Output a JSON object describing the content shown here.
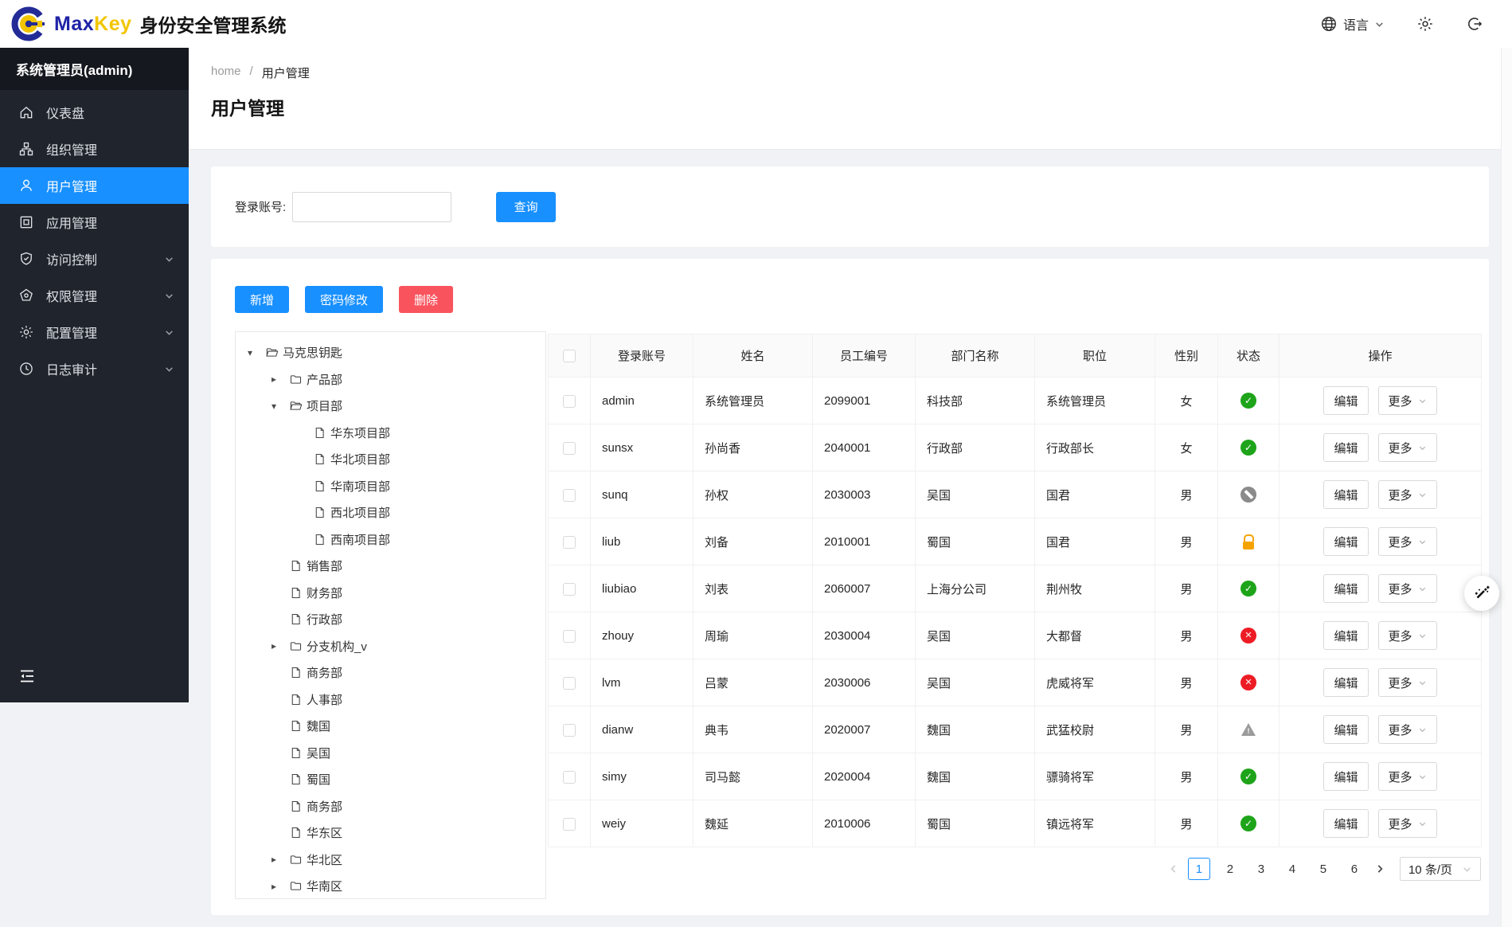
{
  "header": {
    "brand_max": "Max",
    "brand_key": "Key",
    "brand_title": "身份安全管理系统",
    "logo_icon": "maxkey-logo-icon",
    "language": {
      "label": "语言",
      "icon": "globe-icon",
      "chevron_icon": "chevron-down-icon"
    },
    "settings_icon": "gear-icon",
    "logout_icon": "logout-icon"
  },
  "sidebar": {
    "user_label": "系统管理员(admin)",
    "collapse_icon": "collapse-menu-icon",
    "items": [
      {
        "key": "dashboard",
        "label": "仪表盘",
        "icon": "home-icon",
        "active": false,
        "has_submenu": false
      },
      {
        "key": "organizations",
        "label": "组织管理",
        "icon": "org-icon",
        "active": false,
        "has_submenu": false
      },
      {
        "key": "users",
        "label": "用户管理",
        "icon": "user-icon",
        "active": true,
        "has_submenu": false
      },
      {
        "key": "apps",
        "label": "应用管理",
        "icon": "app-icon",
        "active": false,
        "has_submenu": false
      },
      {
        "key": "access-control",
        "label": "访问控制",
        "icon": "shield-icon",
        "active": false,
        "has_submenu": true
      },
      {
        "key": "permissions",
        "label": "权限管理",
        "icon": "gem-icon",
        "active": false,
        "has_submenu": true
      },
      {
        "key": "config",
        "label": "配置管理",
        "icon": "gear-icon",
        "active": false,
        "has_submenu": true
      },
      {
        "key": "audit",
        "label": "日志审计",
        "icon": "clock-icon",
        "active": false,
        "has_submenu": true
      }
    ]
  },
  "breadcrumb": {
    "items": [
      "home",
      "用户管理"
    ],
    "separator": "/"
  },
  "page": {
    "title": "用户管理"
  },
  "search": {
    "label": "登录账号:",
    "input_value": "",
    "button_label": "查询"
  },
  "toolbar": {
    "buttons": [
      {
        "key": "add",
        "label": "新增",
        "type": "primary"
      },
      {
        "key": "change-password",
        "label": "密码修改",
        "type": "primary"
      },
      {
        "key": "delete",
        "label": "删除",
        "type": "danger"
      }
    ]
  },
  "tree": {
    "nodes": [
      {
        "label": "马克思钥匙",
        "level": 0,
        "type": "folder-open",
        "caret": "down"
      },
      {
        "label": "产品部",
        "level": 1,
        "type": "folder",
        "caret": "right"
      },
      {
        "label": "项目部",
        "level": 1,
        "type": "folder-open",
        "caret": "down"
      },
      {
        "label": "华东项目部",
        "level": 2,
        "type": "doc",
        "caret": null
      },
      {
        "label": "华北项目部",
        "level": 2,
        "type": "doc",
        "caret": null
      },
      {
        "label": "华南项目部",
        "level": 2,
        "type": "doc",
        "caret": null
      },
      {
        "label": "西北项目部",
        "level": 2,
        "type": "doc",
        "caret": null
      },
      {
        "label": "西南项目部",
        "level": 2,
        "type": "doc",
        "caret": null
      },
      {
        "label": "销售部",
        "level": 1,
        "type": "doc",
        "caret": null
      },
      {
        "label": "财务部",
        "level": 1,
        "type": "doc",
        "caret": null
      },
      {
        "label": "行政部",
        "level": 1,
        "type": "doc",
        "caret": null
      },
      {
        "label": "分支机构_v",
        "level": 1,
        "type": "folder",
        "caret": "right"
      },
      {
        "label": "商务部",
        "level": 1,
        "type": "doc",
        "caret": null
      },
      {
        "label": "人事部",
        "level": 1,
        "type": "doc",
        "caret": null
      },
      {
        "label": "魏国",
        "level": 1,
        "type": "doc",
        "caret": null
      },
      {
        "label": "吴国",
        "level": 1,
        "type": "doc",
        "caret": null
      },
      {
        "label": "蜀国",
        "level": 1,
        "type": "doc",
        "caret": null
      },
      {
        "label": "商务部",
        "level": 1,
        "type": "doc",
        "caret": null
      },
      {
        "label": "华东区",
        "level": 1,
        "type": "doc",
        "caret": null
      },
      {
        "label": "华北区",
        "level": 1,
        "type": "folder",
        "caret": "right"
      },
      {
        "label": "华南区",
        "level": 1,
        "type": "folder",
        "caret": "right"
      }
    ],
    "icon_names": {
      "folder-open": "folder-open-icon",
      "folder": "folder-icon",
      "doc": "document-icon"
    }
  },
  "table": {
    "columns": [
      "登录账号",
      "姓名",
      "员工编号",
      "部门名称",
      "职位",
      "性别",
      "状态",
      "操作"
    ],
    "actions": {
      "edit": "编辑",
      "more": "更多"
    },
    "status_icons": {
      "active": "check-circle-icon",
      "inactive": "close-circle-icon",
      "disabled": "blocked-circle-icon",
      "locked": "lock-icon",
      "warning": "warning-triangle-icon"
    },
    "rows": [
      {
        "account": "admin",
        "name": "系统管理员",
        "emp_no": "2099001",
        "dept": "科技部",
        "title": "系统管理员",
        "gender": "女",
        "status": "active"
      },
      {
        "account": "sunsx",
        "name": "孙尚香",
        "emp_no": "2040001",
        "dept": "行政部",
        "title": "行政部长",
        "gender": "女",
        "status": "active"
      },
      {
        "account": "sunq",
        "name": "孙权",
        "emp_no": "2030003",
        "dept": "吴国",
        "title": "国君",
        "gender": "男",
        "status": "disabled"
      },
      {
        "account": "liub",
        "name": "刘备",
        "emp_no": "2010001",
        "dept": "蜀国",
        "title": "国君",
        "gender": "男",
        "status": "locked"
      },
      {
        "account": "liubiao",
        "name": "刘表",
        "emp_no": "2060007",
        "dept": "上海分公司",
        "title": "荆州牧",
        "gender": "男",
        "status": "active"
      },
      {
        "account": "zhouy",
        "name": "周瑜",
        "emp_no": "2030004",
        "dept": "吴国",
        "title": "大都督",
        "gender": "男",
        "status": "inactive"
      },
      {
        "account": "lvm",
        "name": "吕蒙",
        "emp_no": "2030006",
        "dept": "吴国",
        "title": "虎威将军",
        "gender": "男",
        "status": "inactive"
      },
      {
        "account": "dianw",
        "name": "典韦",
        "emp_no": "2020007",
        "dept": "魏国",
        "title": "武猛校尉",
        "gender": "男",
        "status": "warning"
      },
      {
        "account": "simy",
        "name": "司马懿",
        "emp_no": "2020004",
        "dept": "魏国",
        "title": "骠骑将军",
        "gender": "男",
        "status": "active"
      },
      {
        "account": "weiy",
        "name": "魏延",
        "emp_no": "2010006",
        "dept": "蜀国",
        "title": "镇远将军",
        "gender": "男",
        "status": "active"
      }
    ]
  },
  "pagination": {
    "prev_icon": "chevron-left-icon",
    "next_icon": "chevron-right-icon",
    "pages": [
      "1",
      "2",
      "3",
      "4",
      "5",
      "6"
    ],
    "current_page": "1",
    "page_size_label": "10 条/页",
    "page_size_chevron_icon": "chevron-down-icon"
  },
  "fab": {
    "icon": "magic-wand-icon"
  },
  "colors": {
    "primary": "#1890ff",
    "danger": "#f9545e",
    "status_active": "#1ea41a",
    "status_inactive": "#ed1c24",
    "status_disabled": "#8b8b8b",
    "status_locked": "#f5a300",
    "sidebar_bg": "#20242d",
    "page_bg": "#f0f2f5"
  }
}
